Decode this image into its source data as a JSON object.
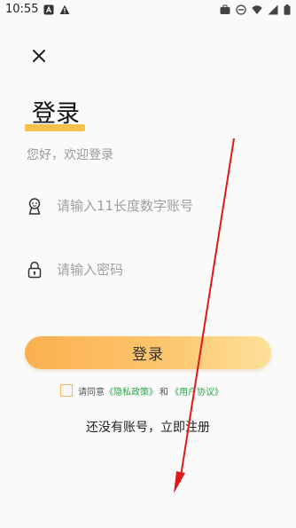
{
  "status_bar": {
    "time": "10:55",
    "left_icons": [
      "notification-a-icon",
      "warning-icon"
    ],
    "right_icons": [
      "briefcase-icon",
      "do-not-disturb-icon",
      "wifi-icon",
      "signal-icon",
      "battery-icon"
    ]
  },
  "header": {
    "close_icon": "close-icon"
  },
  "login": {
    "title": "登录",
    "subtitle": "您好，欢迎登录",
    "account_placeholder": "请输入11长度数字账号",
    "password_placeholder": "请输入密码",
    "submit_label": "登录"
  },
  "agreement": {
    "prefix": "请同意",
    "privacy_link": "《隐私政策》",
    "conjunction": "和",
    "terms_link": "《用户协议》",
    "checked": false
  },
  "register": {
    "label": "还没有账号，立即注册"
  },
  "colors": {
    "accent": "#f6c04d",
    "button_gradient_start": "#fbb04f",
    "button_gradient_end": "#fde09a",
    "link_green": "#2aa84a",
    "annotation_arrow": "#e01818"
  }
}
